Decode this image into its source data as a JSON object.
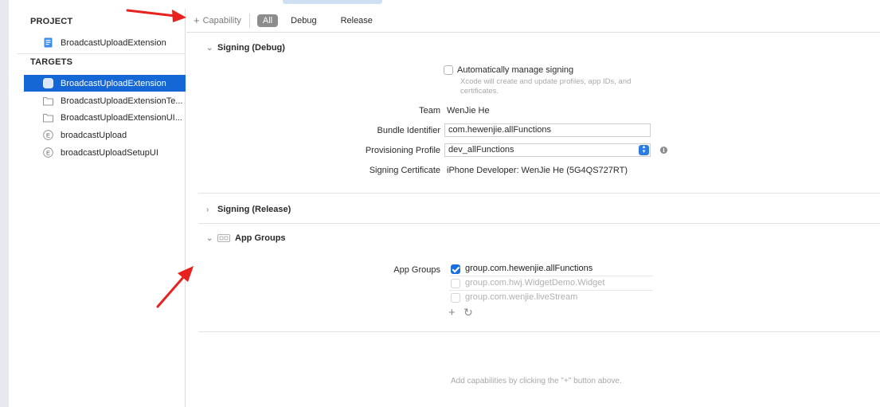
{
  "sidebar": {
    "project_title": "PROJECT",
    "project_items": [
      {
        "label": "BroadcastUploadExtension",
        "icon": "project-file-icon"
      }
    ],
    "targets_title": "TARGETS",
    "target_items": [
      {
        "label": "BroadcastUploadExtension",
        "icon": "app-extension-icon",
        "selected": true
      },
      {
        "label": "BroadcastUploadExtensionTe...",
        "icon": "folder-icon"
      },
      {
        "label": "BroadcastUploadExtensionUI...",
        "icon": "folder-icon"
      },
      {
        "label": "broadcastUpload",
        "icon": "extension-e-icon"
      },
      {
        "label": "broadcastUploadSetupUI",
        "icon": "extension-e-icon"
      }
    ]
  },
  "toolbar": {
    "capability_plus": "+",
    "capability_label": "Capability",
    "tabs": [
      {
        "label": "All",
        "active": true
      },
      {
        "label": "Debug",
        "active": false
      },
      {
        "label": "Release",
        "active": false
      }
    ]
  },
  "signing_debug": {
    "title": "Signing (Debug)",
    "auto_manage_label": "Automatically manage signing",
    "auto_manage_note": "Xcode will create and update profiles, app IDs, and certificates.",
    "auto_manage_checked": false,
    "team_label": "Team",
    "team_value": "WenJie He",
    "bundle_label": "Bundle Identifier",
    "bundle_value": "com.hewenjie.allFunctions",
    "profile_label": "Provisioning Profile",
    "profile_value": "dev_allFunctions",
    "cert_label": "Signing Certificate",
    "cert_value": "iPhone Developer: WenJie He (5G4QS727RT)"
  },
  "signing_release": {
    "title": "Signing (Release)"
  },
  "app_groups": {
    "title": "App Groups",
    "label": "App Groups",
    "groups": [
      {
        "id": "group.com.hewenjie.allFunctions",
        "checked": true,
        "enabled": true
      },
      {
        "id": "group.com.hwj.WidgetDemo.Widget",
        "checked": false,
        "enabled": false
      },
      {
        "id": "group.com.wenjie.liveStream",
        "checked": false,
        "enabled": false
      }
    ],
    "add_symbol": "+",
    "refresh_symbol": "↻"
  },
  "footer": {
    "hint": "Add capabilities by clicking the \"+\" button above."
  },
  "colors": {
    "selection": "#1667d6",
    "checkbox_checked": "#1a6ee0",
    "annotation_arrow": "#e8201e"
  }
}
